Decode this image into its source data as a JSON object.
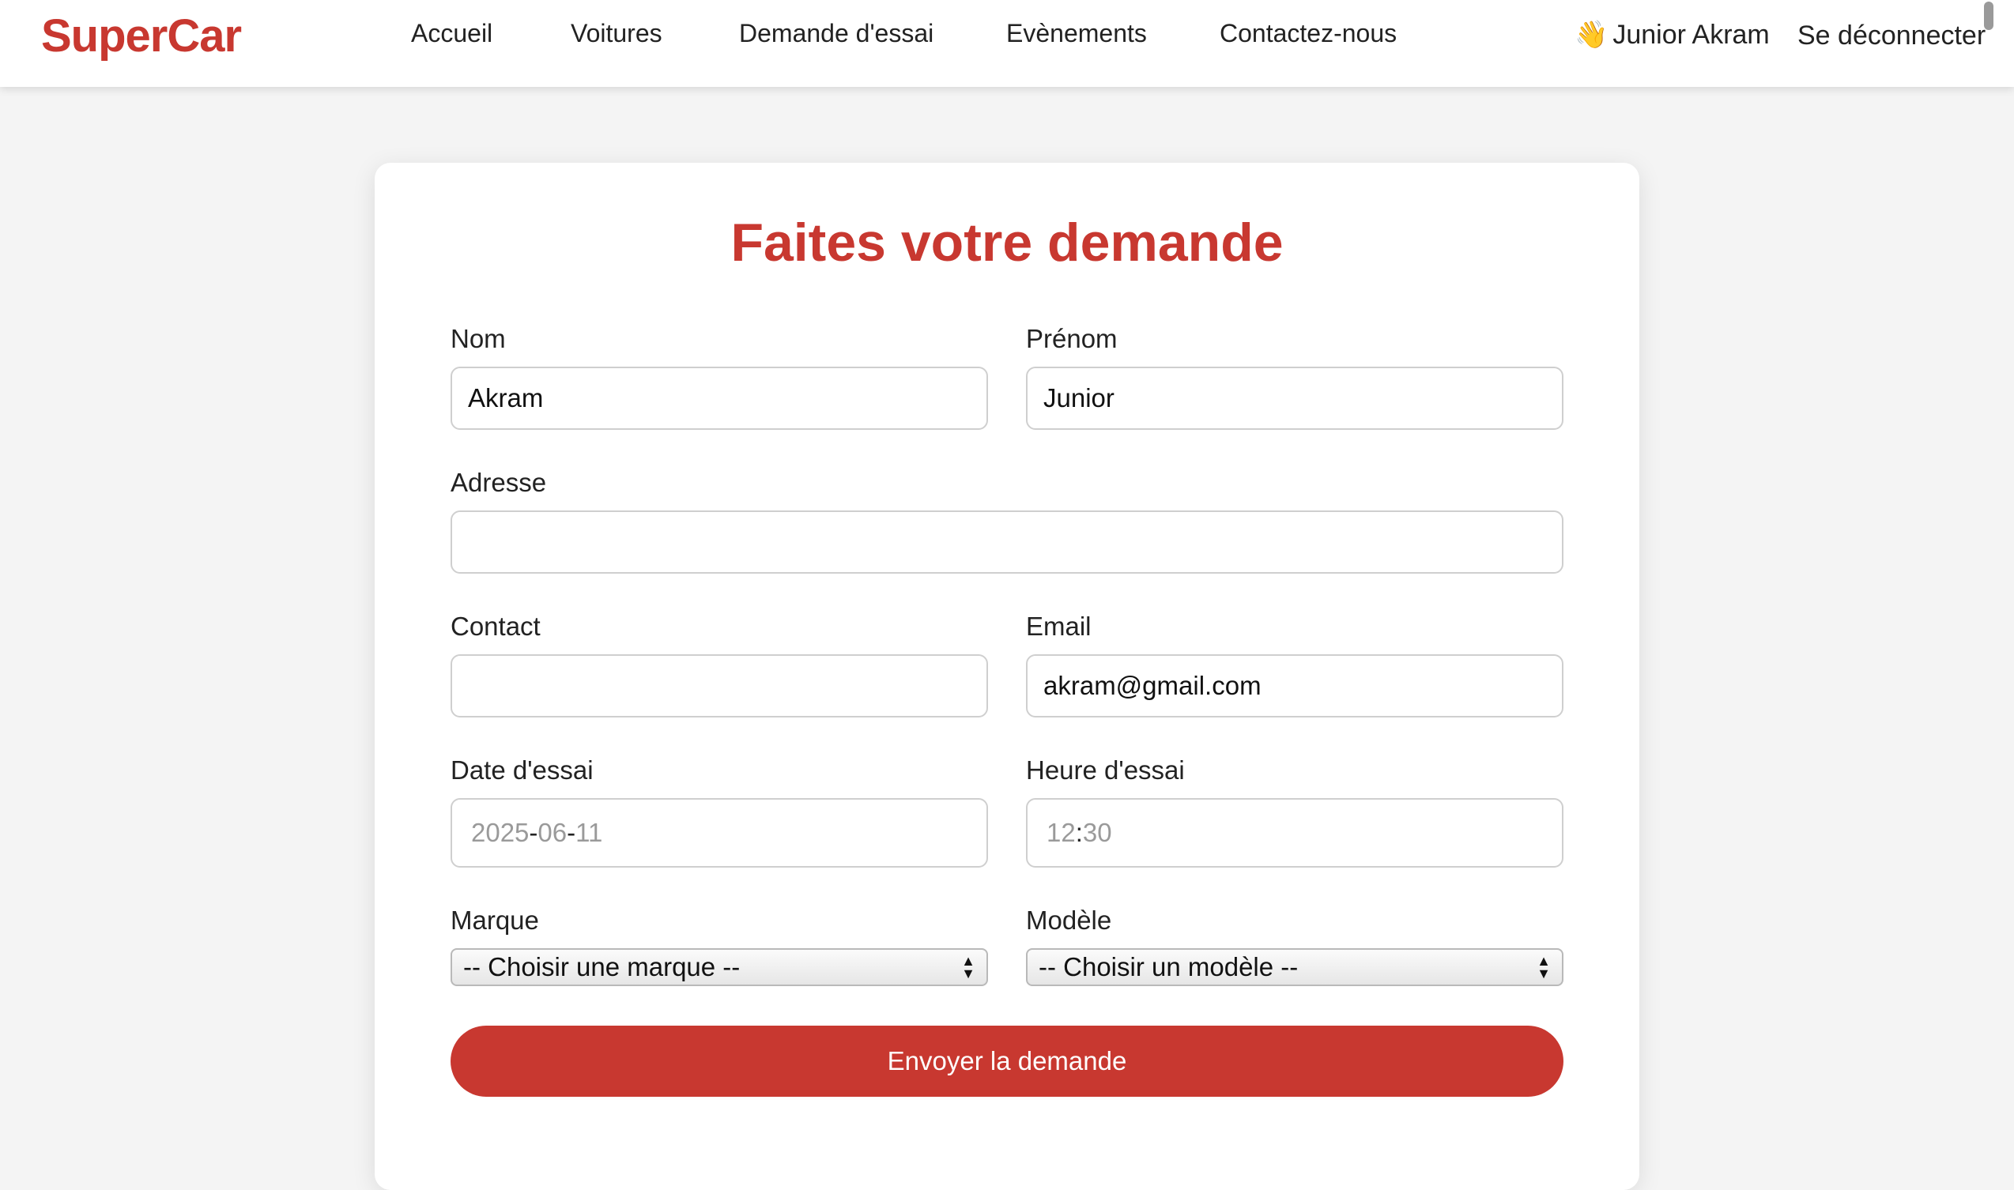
{
  "nav": {
    "logo": "SuperCar",
    "links": [
      "Accueil",
      "Voitures",
      "Demande d'essai",
      "Evènements",
      "Contactez-nous"
    ],
    "user_icon": "👋",
    "user_name": "Junior Akram",
    "logout": "Se déconnecter"
  },
  "form": {
    "title": "Faites votre demande",
    "nom": {
      "label": "Nom",
      "value": "Akram"
    },
    "prenom": {
      "label": "Prénom",
      "value": "Junior"
    },
    "adresse": {
      "label": "Adresse",
      "value": ""
    },
    "contact": {
      "label": "Contact",
      "value": ""
    },
    "email": {
      "label": "Email",
      "value": "akram@gmail.com"
    },
    "date": {
      "label": "Date d'essai",
      "year": "2025",
      "sep": "-",
      "month": "06",
      "day": "11"
    },
    "heure": {
      "label": "Heure d'essai",
      "hour": "12",
      "sep": ":",
      "minute": "30"
    },
    "marque": {
      "label": "Marque",
      "selected": "-- Choisir une marque --"
    },
    "modele": {
      "label": "Modèle",
      "selected": "-- Choisir un modèle --"
    },
    "submit": "Envoyer la demande"
  },
  "colors": {
    "accent": "#c83830",
    "background": "#f4f4f4"
  }
}
